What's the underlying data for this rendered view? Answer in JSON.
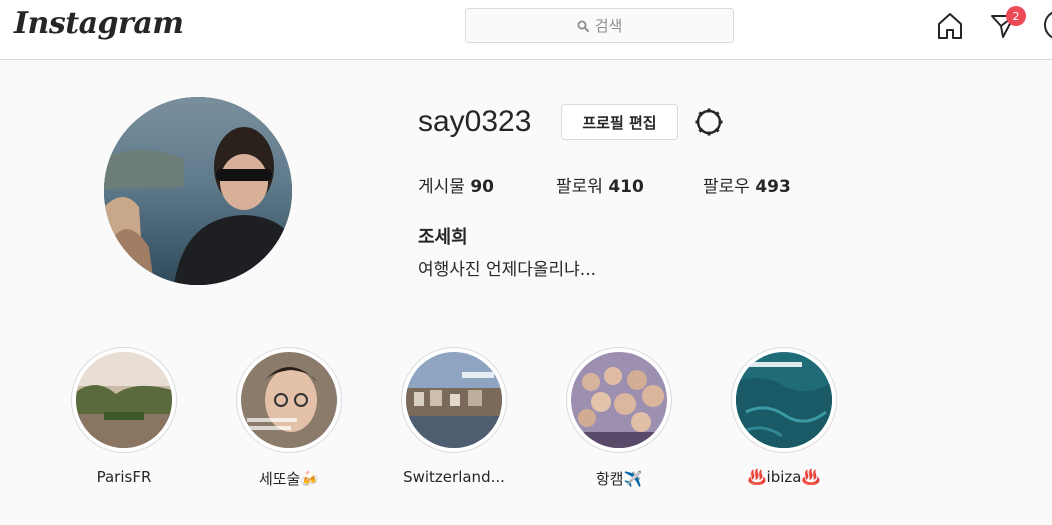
{
  "header": {
    "logo": "Instagram",
    "search_placeholder": "검색",
    "notification_count": "2"
  },
  "profile": {
    "username": "say0323",
    "edit_button": "프로필 편집",
    "stats": [
      {
        "label": "게시물",
        "value": "90"
      },
      {
        "label": "팔로워",
        "value": "410"
      },
      {
        "label": "팔로우",
        "value": "493"
      }
    ],
    "full_name": "조세희",
    "bio": "여행사진 언제다올리냐..."
  },
  "highlights": [
    {
      "label": "ParisFR"
    },
    {
      "label": "세또술🍻"
    },
    {
      "label": "Switzerland..."
    },
    {
      "label": "항캠✈️"
    },
    {
      "label": "♨️ibiza♨️"
    }
  ],
  "colors": {
    "badge": "#ed4956",
    "border": "#dbdbdb",
    "background": "#fafafa",
    "text": "#262626"
  }
}
